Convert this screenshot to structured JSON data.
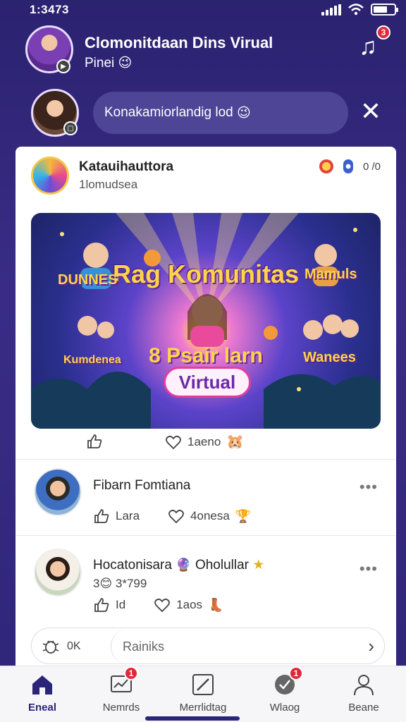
{
  "status": {
    "time": "1:3473"
  },
  "header": {
    "title": "Clomonitdaan Dins Virual",
    "subtitle": "Pinei",
    "music_badge": "3",
    "subtitle_emoji": "😉"
  },
  "compose": {
    "text": "Konakamiorlandig lod",
    "emoji": "😉"
  },
  "post": {
    "author": "Katauihauttora",
    "meta": "1lomudsea",
    "count_label": "0 /0",
    "banner": {
      "title": "Rag Komunitas",
      "subtitle": "8 Psair larn",
      "tag": "Virtual",
      "label_left_top": "DUNNES",
      "label_left_bottom": "Kumdenea",
      "label_right_top": "Mamuls",
      "label_right_bottom": "Wanees"
    },
    "like_count": "1aeno"
  },
  "comments": [
    {
      "name": "Fibarn Fomtiana",
      "like_label": "Lara",
      "heart_label": "4onesa"
    },
    {
      "name": "Hocatonisara",
      "extra": "Oholullar",
      "sub": "3😊 3*799",
      "like_label": "Id",
      "heart_label": "1aos"
    }
  ],
  "reply": {
    "count": "0K",
    "placeholder": "Rainiks"
  },
  "tabs": [
    {
      "label": "Eneal",
      "badge": ""
    },
    {
      "label": "Nemrds",
      "badge": "1"
    },
    {
      "label": "Merrlidtag",
      "badge": ""
    },
    {
      "label": "Wlaog",
      "badge": "1"
    },
    {
      "label": "Beane",
      "badge": ""
    }
  ],
  "colors": {
    "accent": "#2a2578",
    "background": "#2e2578",
    "badge": "#e0283a"
  }
}
